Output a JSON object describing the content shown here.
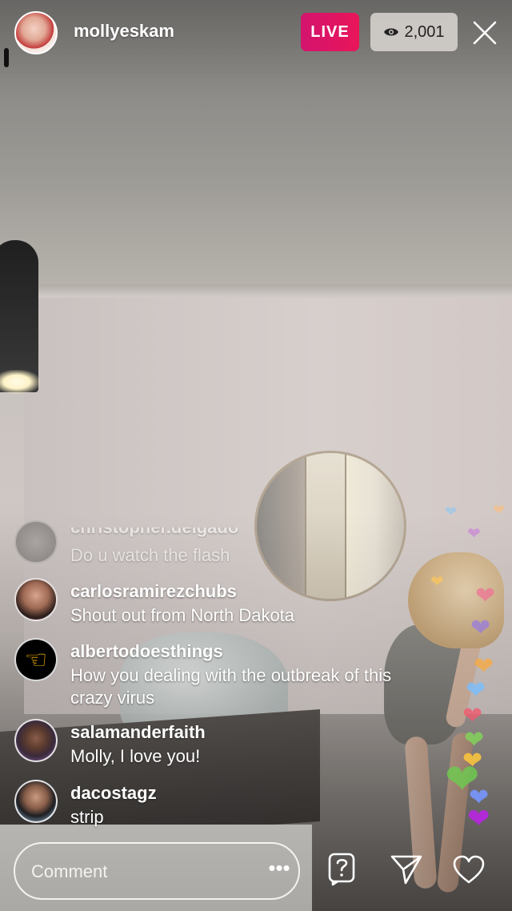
{
  "header": {
    "host_username": "mollyeskam",
    "live_label": "LIVE",
    "viewer_count": "2,001",
    "live_color": "#e0156a"
  },
  "comments": [
    {
      "username": "christopher.delgado",
      "text": "Do u watch the flash",
      "faded": true
    },
    {
      "username": "carlosramirezchubs",
      "text": "Shout out from North Dakota"
    },
    {
      "username": "albertodoesthings",
      "text": "How you dealing with the outbreak of this crazy virus"
    },
    {
      "username": "salamanderfaith",
      "text": "Molly, I love you!"
    },
    {
      "username": "dacostagz",
      "text": "strip"
    }
  ],
  "composer": {
    "placeholder": "Comment",
    "more_label": "•••"
  },
  "icons": {
    "close": "close-icon",
    "eye": "eye-icon",
    "question": "question-sticker-icon",
    "share": "paper-plane-icon",
    "like": "heart-icon"
  }
}
